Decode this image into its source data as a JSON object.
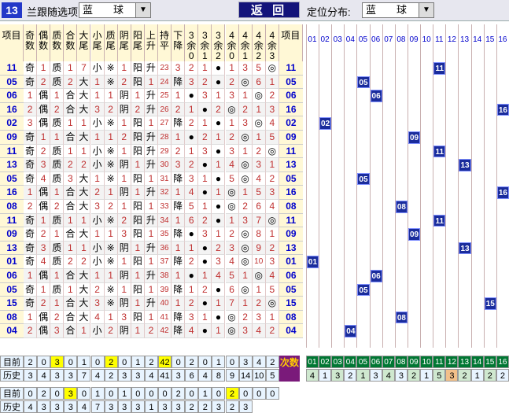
{
  "header": {
    "badge": "13",
    "title": "兰跟随选项",
    "select1": "蓝　　球",
    "back": "返 回",
    "dist_label": "定位分布:",
    "select2": "蓝　　球"
  },
  "columns": [
    "项目",
    "奇数",
    "偶数",
    "质数",
    "合数",
    "大尾",
    "小尾",
    "质尾",
    "阴尾",
    "阳尾",
    "上升",
    "持平",
    "下降",
    "3余0",
    "3余1",
    "3余2",
    "4余0",
    "4余1",
    "4余2",
    "4余3",
    "项目"
  ],
  "numbers": [
    "01",
    "02",
    "03",
    "04",
    "05",
    "06",
    "07",
    "08",
    "09",
    "10",
    "11",
    "12",
    "13",
    "14",
    "15",
    "16"
  ],
  "rows": [
    {
      "id": "11",
      "c": [
        "奇",
        "1",
        "质",
        "1",
        "7",
        "小",
        "※",
        "1",
        "阳",
        "升",
        "23",
        "3",
        "2",
        "1",
        "●",
        "1",
        "3",
        "5",
        "◎"
      ],
      "ball": 11
    },
    {
      "id": "05",
      "c": [
        "奇",
        "2",
        "质",
        "2",
        "大",
        "1",
        "※",
        "2",
        "阳",
        "1",
        "24",
        "降",
        "3",
        "2",
        "●",
        "2",
        "◎",
        "6",
        "1"
      ],
      "ball": 5
    },
    {
      "id": "06",
      "c": [
        "1",
        "偶",
        "1",
        "合",
        "大",
        "1",
        "1",
        "阴",
        "1",
        "升",
        "25",
        "1",
        "●",
        "3",
        "1",
        "3",
        "1",
        "◎",
        "2"
      ],
      "ball": 6
    },
    {
      "id": "16",
      "c": [
        "2",
        "偶",
        "2",
        "合",
        "大",
        "3",
        "2",
        "阴",
        "2",
        "升",
        "26",
        "2",
        "1",
        "●",
        "2",
        "◎",
        "2",
        "1",
        "3"
      ],
      "ball": 16
    },
    {
      "id": "02",
      "c": [
        "3",
        "偶",
        "质",
        "1",
        "1",
        "小",
        "※",
        "1",
        "阳",
        "1",
        "27",
        "降",
        "2",
        "1",
        "●",
        "1",
        "3",
        "◎",
        "4"
      ],
      "ball": 2
    },
    {
      "id": "09",
      "c": [
        "奇",
        "1",
        "1",
        "合",
        "大",
        "1",
        "1",
        "2",
        "阳",
        "升",
        "28",
        "1",
        "●",
        "2",
        "1",
        "2",
        "◎",
        "1",
        "5"
      ],
      "ball": 9
    },
    {
      "id": "11",
      "c": [
        "奇",
        "2",
        "质",
        "1",
        "1",
        "小",
        "※",
        "1",
        "阳",
        "升",
        "29",
        "2",
        "1",
        "3",
        "●",
        "3",
        "1",
        "2",
        "◎"
      ],
      "ball": 11
    },
    {
      "id": "13",
      "c": [
        "奇",
        "3",
        "质",
        "2",
        "2",
        "小",
        "※",
        "阴",
        "1",
        "升",
        "30",
        "3",
        "2",
        "●",
        "1",
        "4",
        "◎",
        "3",
        "1"
      ],
      "ball": 13
    },
    {
      "id": "05",
      "c": [
        "奇",
        "4",
        "质",
        "3",
        "大",
        "1",
        "※",
        "1",
        "阳",
        "1",
        "31",
        "降",
        "3",
        "1",
        "●",
        "5",
        "◎",
        "4",
        "2"
      ],
      "ball": 5
    },
    {
      "id": "16",
      "c": [
        "1",
        "偶",
        "1",
        "合",
        "大",
        "2",
        "1",
        "阴",
        "1",
        "升",
        "32",
        "1",
        "4",
        "●",
        "1",
        "◎",
        "1",
        "5",
        "3"
      ],
      "ball": 16
    },
    {
      "id": "08",
      "c": [
        "2",
        "偶",
        "2",
        "合",
        "大",
        "3",
        "2",
        "1",
        "阳",
        "1",
        "33",
        "降",
        "5",
        "1",
        "●",
        "◎",
        "2",
        "6",
        "4"
      ],
      "ball": 8
    },
    {
      "id": "11",
      "c": [
        "奇",
        "1",
        "质",
        "1",
        "1",
        "小",
        "※",
        "2",
        "阳",
        "升",
        "34",
        "1",
        "6",
        "2",
        "●",
        "1",
        "3",
        "7",
        "◎"
      ],
      "ball": 11
    },
    {
      "id": "09",
      "c": [
        "奇",
        "2",
        "1",
        "合",
        "大",
        "1",
        "1",
        "3",
        "阳",
        "1",
        "35",
        "降",
        "●",
        "3",
        "1",
        "2",
        "◎",
        "8",
        "1"
      ],
      "ball": 9
    },
    {
      "id": "13",
      "c": [
        "奇",
        "3",
        "质",
        "1",
        "1",
        "小",
        "※",
        "阴",
        "1",
        "升",
        "36",
        "1",
        "1",
        "●",
        "2",
        "3",
        "◎",
        "9",
        "2"
      ],
      "ball": 13
    },
    {
      "id": "01",
      "c": [
        "奇",
        "4",
        "质",
        "2",
        "2",
        "小",
        "※",
        "1",
        "阳",
        "1",
        "37",
        "降",
        "2",
        "●",
        "3",
        "4",
        "◎",
        "10",
        "3"
      ],
      "ball": 1
    },
    {
      "id": "06",
      "c": [
        "1",
        "偶",
        "1",
        "合",
        "大",
        "1",
        "1",
        "阴",
        "1",
        "升",
        "38",
        "1",
        "●",
        "1",
        "4",
        "5",
        "1",
        "◎",
        "4"
      ],
      "ball": 6
    },
    {
      "id": "05",
      "c": [
        "奇",
        "1",
        "质",
        "1",
        "大",
        "2",
        "※",
        "1",
        "阳",
        "1",
        "39",
        "降",
        "1",
        "2",
        "●",
        "6",
        "◎",
        "1",
        "5"
      ],
      "ball": 5
    },
    {
      "id": "15",
      "c": [
        "奇",
        "2",
        "1",
        "合",
        "大",
        "3",
        "※",
        "阴",
        "1",
        "升",
        "40",
        "1",
        "2",
        "●",
        "1",
        "7",
        "1",
        "2",
        "◎"
      ],
      "ball": 15
    },
    {
      "id": "08",
      "c": [
        "1",
        "偶",
        "2",
        "合",
        "大",
        "4",
        "1",
        "3",
        "阳",
        "1",
        "41",
        "降",
        "3",
        "1",
        "●",
        "◎",
        "2",
        "3",
        "1"
      ],
      "ball": 8
    },
    {
      "id": "04",
      "c": [
        "2",
        "偶",
        "3",
        "合",
        "1",
        "小",
        "2",
        "阴",
        "1",
        "2",
        "42",
        "降",
        "4",
        "●",
        "1",
        "◎",
        "3",
        "4",
        "2"
      ],
      "ball": 4
    }
  ],
  "stats": {
    "label_now": "目前",
    "label_hist": "历史",
    "now": [
      "2",
      "0",
      "3",
      "0",
      "1",
      "0",
      "2",
      "0",
      "1",
      "2",
      "42",
      "0",
      "2",
      "0",
      "1",
      "0",
      "3",
      "4",
      "2"
    ],
    "hist": [
      "3",
      "4",
      "3",
      "3",
      "7",
      "4",
      "2",
      "3",
      "3",
      "4",
      "41",
      "3",
      "6",
      "4",
      "8",
      "9",
      "14",
      "10",
      "5"
    ],
    "cishu": "次数",
    "cishu_vals": [
      "4",
      "1",
      "3",
      "2",
      "1",
      "3",
      "4",
      "3",
      "2",
      "1",
      "5",
      "3",
      "2",
      "1",
      "2",
      "2"
    ]
  },
  "stats2": {
    "label_now": "目前",
    "label_hist": "历史",
    "now": [
      "0",
      "2",
      "0",
      "3",
      "0",
      "1",
      "0",
      "1",
      "0",
      "0",
      "0",
      "2",
      "0",
      "1",
      "0",
      "2",
      "0",
      "0",
      "0"
    ],
    "hist": [
      "4",
      "3",
      "3",
      "3",
      "4",
      "7",
      "3",
      "3",
      "3",
      "1",
      "3",
      "3",
      "2",
      "2",
      "3",
      "2",
      "3"
    ]
  },
  "colors": {
    "ball": "#1a2c9c",
    "header_bg": "#fff8d6",
    "highlight": "#ffff00",
    "cishu_green": "#007733",
    "back_btn": "#13137a"
  }
}
